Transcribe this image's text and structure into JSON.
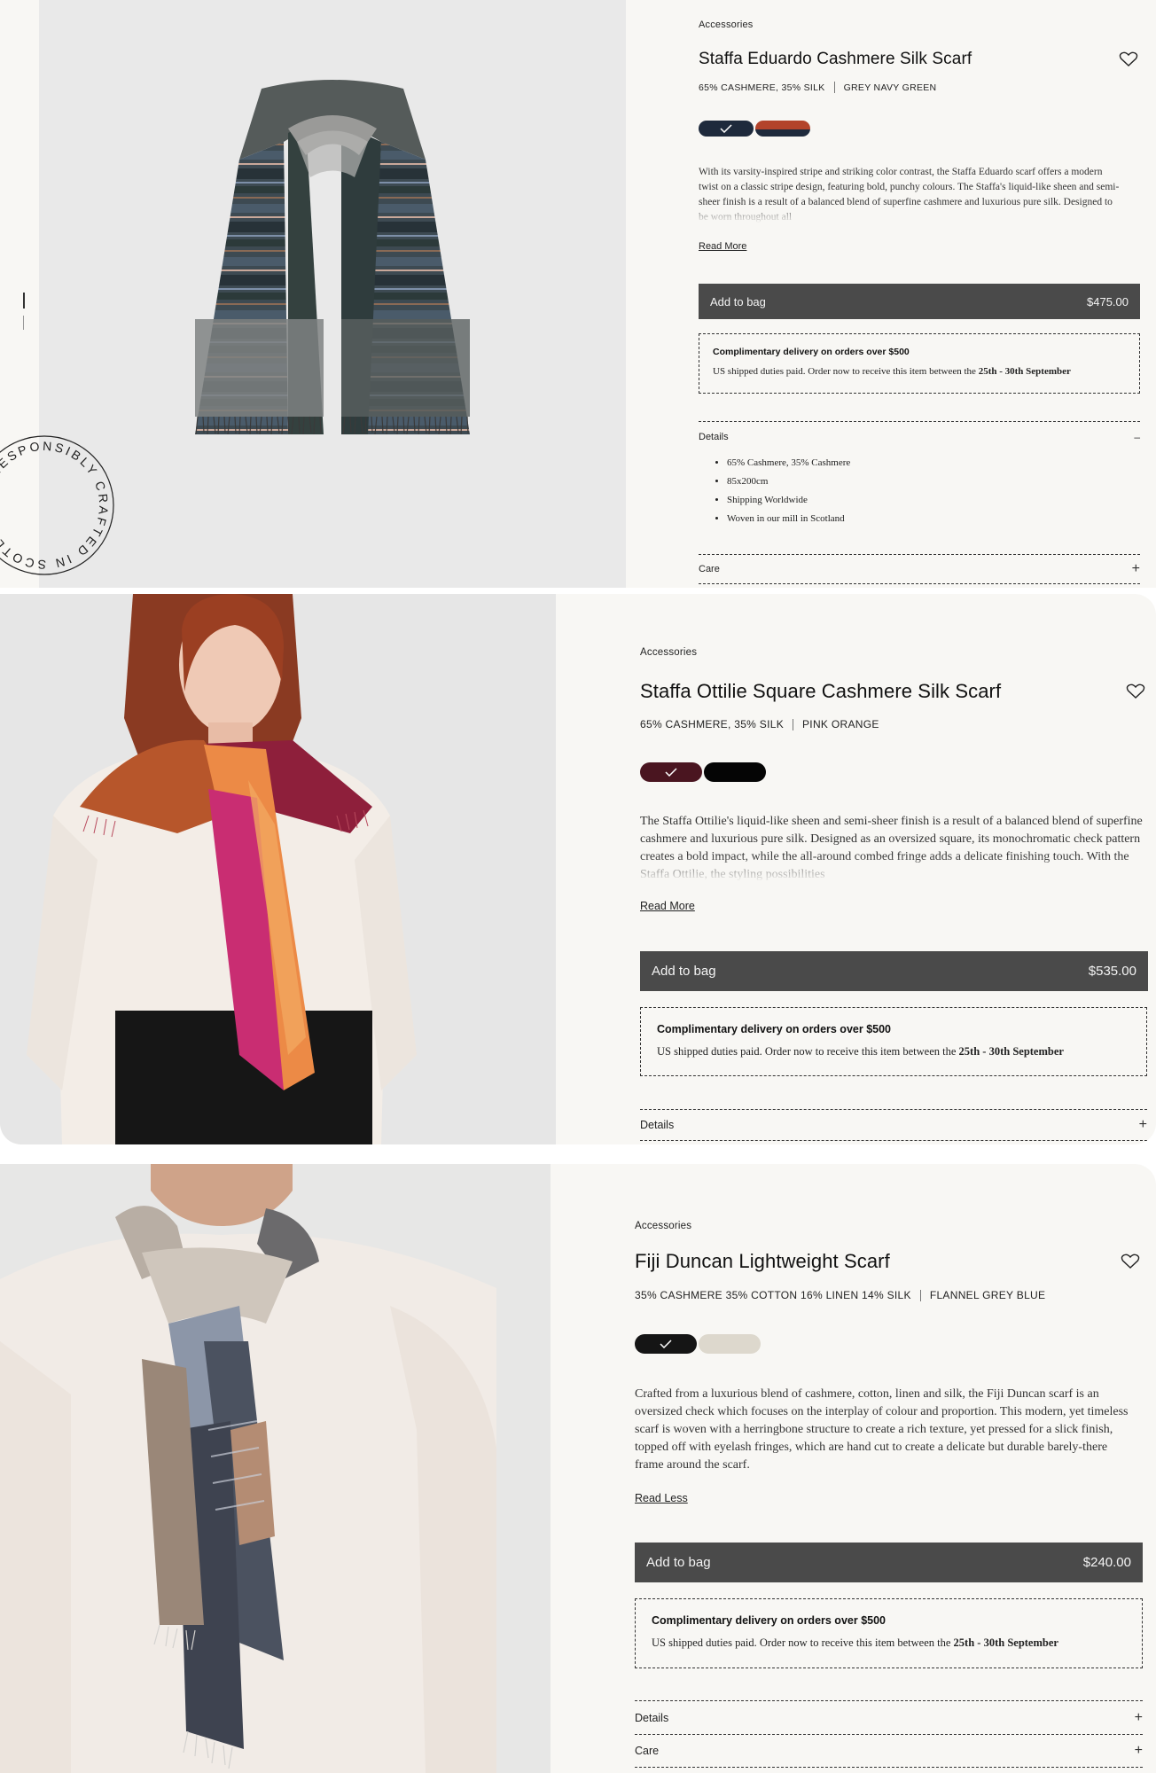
{
  "products": [
    {
      "category": "Accessories",
      "title": "Staffa Eduardo Cashmere Silk Scarf",
      "composition": "65% CASHMERE, 35% SILK",
      "color_name": "GREY NAVY GREEN",
      "swatch_colors": [
        "#1e2a3c",
        "#b3432b"
      ],
      "description": "With its varsity-inspired stripe and striking color contrast, the Staffa Eduardo scarf offers a modern twist on a classic stripe design, featuring bold, punchy colours. The Staffa's liquid-like sheen and semi-sheer finish is a result of a balanced blend of superfine cashmere and luxurious pure silk. Designed to be worn throughout all",
      "read_toggle": "Read More",
      "add_to_bag": "Add to bag",
      "price": "$475.00",
      "delivery_heading": "Complimentary delivery on orders over $500",
      "delivery_text": "US shipped duties paid. Order now to receive this item between the ",
      "delivery_dates": "25th - 30th September",
      "details_label": "Details",
      "details_toggle": "–",
      "details_items": [
        "65% Cashmere, 35% Cashmere",
        "85x200cm",
        "Shipping Worldwide",
        "Woven in our mill in Scotland"
      ],
      "care_label": "Care",
      "care_toggle": "+",
      "badge_text": "RESPONSIBLY CRAFTED IN SCOTLAND"
    },
    {
      "category": "Accessories",
      "title": "Staffa Ottilie Square Cashmere Silk Scarf",
      "composition": "65% CASHMERE, 35% SILK",
      "color_name": "PINK ORANGE",
      "swatch_colors": [
        "#4a1520",
        "#050505"
      ],
      "description": "The Staffa Ottilie's liquid-like sheen and semi-sheer finish is a result of a balanced blend of superfine cashmere and luxurious pure silk. Designed as an oversized square, its monochromatic check pattern creates a bold impact, while the all-around combed fringe adds a delicate finishing touch. With the Staffa Ottilie, the styling possibilities",
      "read_toggle": "Read More",
      "add_to_bag": "Add to bag",
      "price": "$535.00",
      "delivery_heading": "Complimentary delivery on orders over $500",
      "delivery_text": "US shipped duties paid. Order now to receive this item between the ",
      "delivery_dates": "25th - 30th September",
      "details_label": "Details",
      "details_toggle": "+"
    },
    {
      "category": "Accessories",
      "title": "Fiji Duncan Lightweight Scarf",
      "composition": "35% CASHMERE 35% COTTON 16% LINEN 14% SILK",
      "color_name": "FLANNEL GREY BLUE",
      "swatch_colors": [
        "#151515",
        "#ddd8cd"
      ],
      "description": "Crafted from a luxurious blend of cashmere, cotton, linen and silk, the Fiji Duncan scarf is an oversized check which focuses on the interplay of colour and proportion. This modern, yet timeless scarf is woven with a herringbone structure to create a rich texture, yet pressed for a slick finish, topped off with eyelash fringes, which are hand cut to create a delicate but durable barely-there frame around the scarf.",
      "read_toggle": "Read Less",
      "add_to_bag": "Add to bag",
      "price": "$240.00",
      "delivery_heading": "Complimentary delivery on orders over $500",
      "delivery_text": "US shipped duties paid. Order now to receive this item between the ",
      "delivery_dates": "25th - 30th September",
      "details_label": "Details",
      "details_toggle": "+",
      "care_label": "Care",
      "care_toggle": "+"
    }
  ]
}
